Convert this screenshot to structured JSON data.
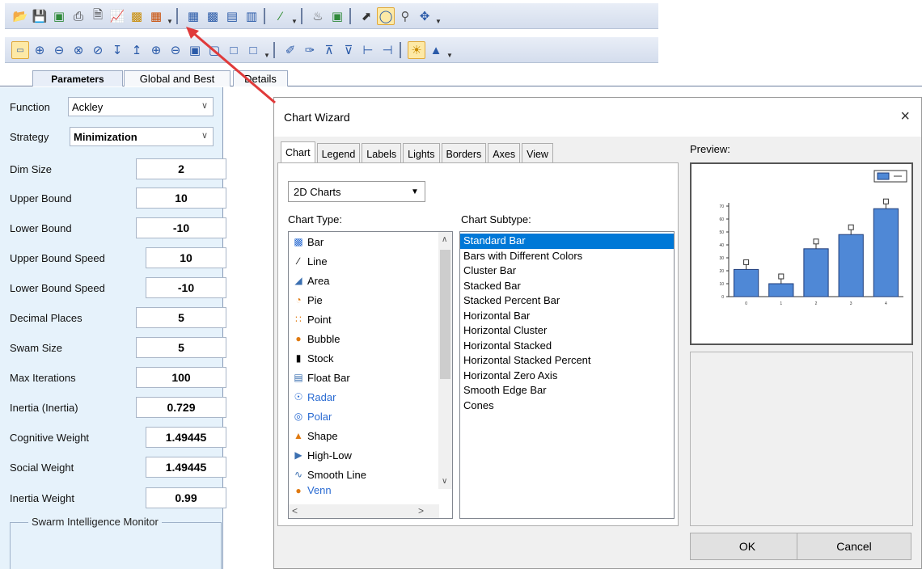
{
  "toolbar1": {
    "icons": [
      "open-folder-icon",
      "save-icon",
      "image-icon",
      "print-icon",
      "document-icon",
      "chart-edit-icon",
      "bar-chart-icon",
      "palette-icon"
    ]
  },
  "tabs": [
    {
      "label": "Parameters"
    },
    {
      "label": "Global and Best"
    },
    {
      "label": "Details"
    }
  ],
  "parameters": {
    "function": {
      "label": "Function",
      "value": "Ackley"
    },
    "strategy": {
      "label": "Strategy",
      "value": "Minimization"
    },
    "fields": [
      {
        "label": "Dim Size",
        "value": "2"
      },
      {
        "label": "Upper Bound",
        "value": "10"
      },
      {
        "label": "Lower Bound",
        "value": "-10"
      },
      {
        "label": "Upper Bound Speed",
        "value": "10"
      },
      {
        "label": "Lower Bound Speed",
        "value": "-10"
      },
      {
        "label": "Decimal Places",
        "value": "5"
      },
      {
        "label": "Swam Size",
        "value": "5"
      },
      {
        "label": "Max Iterations",
        "value": "100"
      },
      {
        "label": "Inertia (Inertia)",
        "value": "0.729"
      },
      {
        "label": "Cognitive Weight",
        "value": "1.49445"
      },
      {
        "label": "Social Weight",
        "value": "1.49445"
      },
      {
        "label": "Inertia Weight",
        "value": "0.99"
      }
    ],
    "monitor_label": "Swarm Intelligence Monitor"
  },
  "dialog": {
    "title": "Chart Wizard",
    "close_glyph": "×",
    "tabs": [
      "Chart",
      "Legend",
      "Labels",
      "Lights",
      "Borders",
      "Axes",
      "View"
    ],
    "chart_group": "2D Charts",
    "chart_type_label": "Chart Type:",
    "chart_subtype_label": "Chart Subtype:",
    "preview_label": "Preview:",
    "chart_types": [
      {
        "label": "Bar",
        "icon": "bar-type-icon",
        "enabled": true
      },
      {
        "label": "Line",
        "icon": "line-type-icon",
        "enabled": true
      },
      {
        "label": "Area",
        "icon": "area-type-icon",
        "enabled": true
      },
      {
        "label": "Pie",
        "icon": "pie-type-icon",
        "enabled": true
      },
      {
        "label": "Point",
        "icon": "point-type-icon",
        "enabled": true
      },
      {
        "label": "Bubble",
        "icon": "bubble-type-icon",
        "enabled": true
      },
      {
        "label": "Stock",
        "icon": "stock-type-icon",
        "enabled": true
      },
      {
        "label": "Float Bar",
        "icon": "float-bar-type-icon",
        "enabled": true
      },
      {
        "label": "Radar",
        "icon": "radar-type-icon",
        "enabled": false
      },
      {
        "label": "Polar",
        "icon": "polar-type-icon",
        "enabled": false
      },
      {
        "label": "Shape",
        "icon": "shape-type-icon",
        "enabled": true
      },
      {
        "label": "High-Low",
        "icon": "high-low-type-icon",
        "enabled": true
      },
      {
        "label": "Smooth Line",
        "icon": "smooth-line-type-icon",
        "enabled": true
      },
      {
        "label": "Venn",
        "icon": "venn-type-icon",
        "enabled": false
      }
    ],
    "chart_subtypes": [
      "Standard Bar",
      "Bars with Different Colors",
      "Cluster Bar",
      "Stacked Bar",
      "Stacked Percent Bar",
      "Horizontal Bar",
      "Horizontal Cluster",
      "Horizontal Stacked",
      "Horizontal Stacked Percent",
      "Horizontal Zero Axis",
      "Smooth Edge Bar",
      "Cones"
    ],
    "selected_subtype": "Standard Bar",
    "ok_label": "OK",
    "cancel_label": "Cancel"
  },
  "chart_data": {
    "type": "bar",
    "categories": [
      "0",
      "1",
      "2",
      "3",
      "4"
    ],
    "values": [
      21,
      10,
      37,
      48,
      68
    ],
    "ylim": [
      0,
      70
    ],
    "yticks": [
      "0",
      "10",
      "20",
      "30",
      "40",
      "50",
      "60",
      "70"
    ],
    "bar_color": "#4f88d6",
    "grid": false,
    "legend": "top-right"
  }
}
